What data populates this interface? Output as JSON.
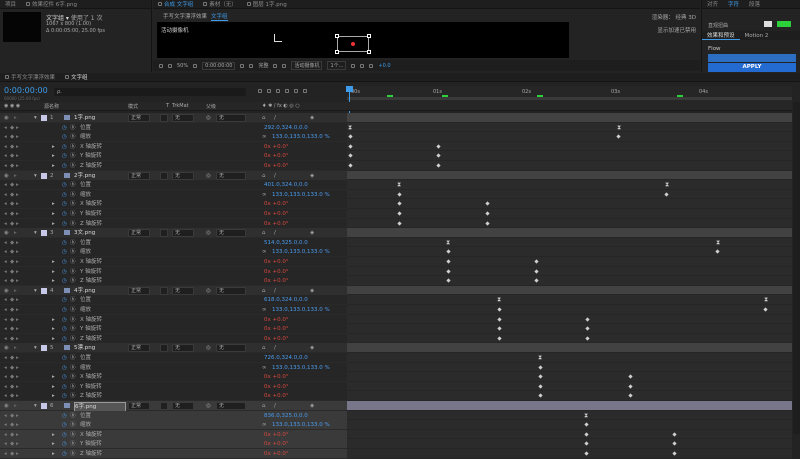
{
  "project_panel": {
    "tab1": "项目",
    "tab2": "效果控件 6字.png",
    "comp_name": "文字组",
    "usage": "使用了 1 次",
    "dims": "1067 x 800 (1.00)",
    "duration": "Δ 0:00:05:00, 25.00 fps"
  },
  "comp_viewer": {
    "tab1": "合成 文字组",
    "tab2": "素材（无）",
    "tab3": "图层 1字.png",
    "breadcrumb": "手写文字漂浮效果",
    "breadcrumb2": "文字组",
    "camera_label": "活动摄像机",
    "renderer": "渲染器：",
    "renderer_value": "经典 3D",
    "disabled": "显示加速已禁用"
  },
  "viewer_toolbar": {
    "zoom": "50%",
    "time": "0:00:00:00",
    "quality": "完整",
    "camera": "活动摄像机",
    "views": "1个...",
    "exposure": "+0.0"
  },
  "right_panel": {
    "tab1": "对齐",
    "tab2": "字符",
    "tab3": "段落",
    "tab4": "直观扭曲",
    "tab5": "效果和预设",
    "tab6": "Motion 2",
    "flow": "Flow",
    "apply": "APPLY"
  },
  "timeline": {
    "tab1": "手写文字漂浮效果",
    "tab2": "文字组",
    "timecode": "0:00:00:00",
    "timecode_sub": "00000 (25.00 fps)",
    "search": "ρ.",
    "col_name": "源名称",
    "col_mode": "模式",
    "col_t": "T",
    "col_trkmat": "TrkMat",
    "col_parent": "父级",
    "ruler": [
      "00s",
      "01s",
      "02s",
      "03s",
      "04s"
    ]
  },
  "props": {
    "pos": "位置",
    "scale": "缩放",
    "rx": "X 轴旋转",
    "ry": "Y 轴旋转",
    "rz": "Z 轴旋转"
  },
  "modes": {
    "normal": "正常",
    "none": "无"
  },
  "layers": [
    {
      "num": "1",
      "name": "1字.png",
      "pos": "292.0,324.0,0.0",
      "scale": "133.0,133.0,133.0 %",
      "rx": "0x +0.0°",
      "ry": "0x +0.0°",
      "rz": "0x +0.0°"
    },
    {
      "num": "2",
      "name": "2字.png",
      "pos": "401.0,324.0,0.0",
      "scale": "133.0,133.0,133.0 %",
      "rx": "0x +0.0°",
      "ry": "0x +0.0°",
      "rz": "0x +0.0°"
    },
    {
      "num": "3",
      "name": "3文.png",
      "pos": "514.0,325.0,0.0",
      "scale": "133.0,133.0,133.0 %",
      "rx": "0x +0.0°",
      "ry": "0x +0.0°",
      "rz": "0x +0.0°"
    },
    {
      "num": "4",
      "name": "4字.png",
      "pos": "618.0,324.0,0.0",
      "scale": "133.0,133.0,133.0 %",
      "rx": "0x +0.0°",
      "ry": "0x +0.0°",
      "rz": "0x +0.0°"
    },
    {
      "num": "5",
      "name": "5漂.png",
      "pos": "726.0,324.0,0.0",
      "scale": "133.0,133.0,133.0 %",
      "rx": "0x +0.0°",
      "ry": "0x +0.0°",
      "rz": "0x +0.0°"
    },
    {
      "num": "6",
      "name": "6字.png",
      "pos": "836.0,325.0,0.0",
      "scale": "133.0,133.0,133.0 %",
      "rx": "0x +0.0°",
      "ry": "0x +0.0°",
      "rz": "0x +0.0°"
    }
  ]
}
